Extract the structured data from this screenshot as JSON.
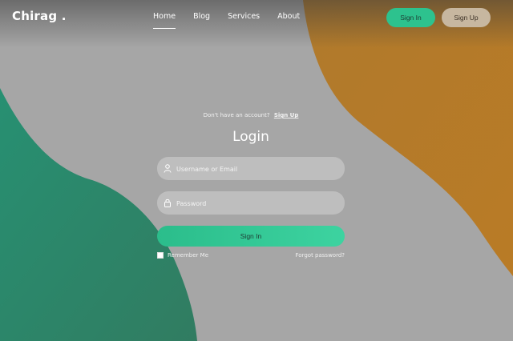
{
  "colors": {
    "background": "#a6a6a6",
    "green_shape": "#2a8a67",
    "orange_shape": "#b57a2a",
    "accent_green": "#2dc28e",
    "signup_button": "#c7b7a0"
  },
  "brand": "Chirag .",
  "nav": {
    "links": [
      "Home",
      "Blog",
      "Services",
      "About"
    ],
    "active": "Home",
    "signin_label": "Sign In",
    "signup_label": "Sign Up"
  },
  "login": {
    "account_prompt": "Don't have an account?",
    "signup_link": "Sign Up",
    "title": "Login",
    "username_placeholder": "Username or Email",
    "password_placeholder": "Password",
    "submit_label": "Sign In",
    "remember_label": "Remember Me",
    "forgot_label": "Forgot password?"
  },
  "icons": {
    "username": "user-icon",
    "password": "lock-icon"
  }
}
